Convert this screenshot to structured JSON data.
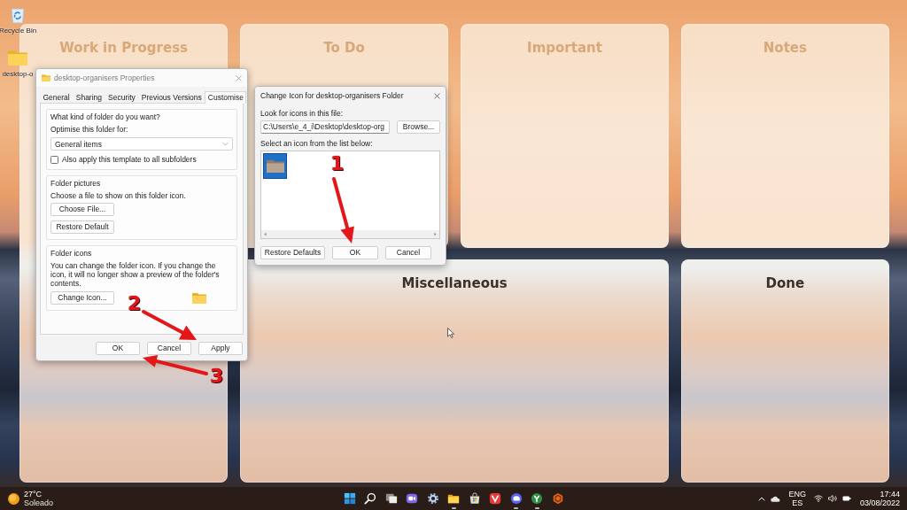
{
  "desktop_icons": [
    {
      "kind": "recyclebin",
      "label": "Recycle Bin"
    },
    {
      "kind": "folder",
      "label": "desktop-o"
    }
  ],
  "tiles": [
    {
      "title": "Work in Progress"
    },
    {
      "title": "To Do"
    },
    {
      "title": "Important"
    },
    {
      "title": "Notes"
    },
    {
      "title": "Miscellaneous"
    },
    {
      "title": "Done"
    }
  ],
  "properties_dialog": {
    "title": "desktop-organisers Properties",
    "tabs": [
      {
        "label": "General",
        "selected": false
      },
      {
        "label": "Sharing",
        "selected": false
      },
      {
        "label": "Security",
        "selected": false
      },
      {
        "label": "Previous Versions",
        "selected": false
      },
      {
        "label": "Customise",
        "selected": true
      }
    ],
    "folder_type": {
      "legend": "What kind of folder do you want?",
      "optimise_label": "Optimise this folder for:",
      "dropdown_value": "General items",
      "checkbox": {
        "label": "Also apply this template to all subfolders",
        "checked": false
      }
    },
    "folder_pictures": {
      "legend": "Folder pictures",
      "text": "Choose a file to show on this folder icon.",
      "buttons": [
        "Choose File...",
        "Restore Default"
      ]
    },
    "folder_icons": {
      "legend": "Folder icons",
      "text": "You can change the folder icon. If you change the icon, it will no longer show a preview of the folder's contents.",
      "button": "Change Icon..."
    },
    "buttons": [
      "OK",
      "Cancel",
      "Apply"
    ]
  },
  "change_icon_dialog": {
    "title": "Change Icon for desktop-organisers Folder",
    "look_label": "Look for icons in this file:",
    "path": "C:\\Users\\e_4_i\\Desktop\\desktop-org",
    "browse_button": "Browse...",
    "list_label": "Select an icon from the list below:",
    "icons": [
      {
        "selected": true
      }
    ],
    "buttons": [
      "Restore Defaults",
      "OK",
      "Cancel"
    ]
  },
  "annotations": [
    {
      "label": "1"
    },
    {
      "label": "2"
    },
    {
      "label": "3"
    }
  ],
  "taskbar": {
    "weather": {
      "temperature": "27°C",
      "condition": "Soleado"
    },
    "apps": [
      {
        "kind": "start",
        "running": false
      },
      {
        "kind": "search",
        "running": false
      },
      {
        "kind": "taskview",
        "running": false
      },
      {
        "kind": "chat",
        "running": false
      },
      {
        "kind": "settings",
        "running": false
      },
      {
        "kind": "explorer",
        "running": true
      },
      {
        "kind": "store",
        "running": false
      },
      {
        "kind": "squareapp",
        "running": false
      },
      {
        "kind": "roundapp",
        "running": true
      },
      {
        "kind": "forkapp",
        "running": true
      },
      {
        "kind": "hexapp",
        "running": false
      }
    ],
    "language": "ENG",
    "region": "ES",
    "time": "17:44",
    "date": "03/08/2022"
  }
}
